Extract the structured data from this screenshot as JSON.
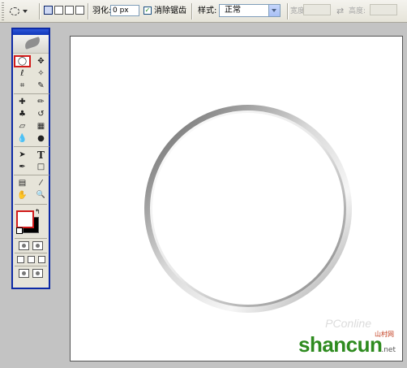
{
  "options_bar": {
    "feather_label": "羽化:",
    "feather_value": "0 px",
    "antialias_checked": "✓",
    "antialias_label": "消除锯齿",
    "style_label": "样式:",
    "style_value": "正常",
    "width_label": "宽度:",
    "height_label": "高度:",
    "swap_icon": "⇄"
  },
  "tools": {
    "glyphs": {
      "elliptical-marquee": "◯",
      "move": "✥",
      "lasso": "ℓ",
      "magic-wand": "✧",
      "crop": "⌗",
      "slice": "✎",
      "healing-brush": "✚",
      "brush": "✏",
      "clone-stamp": "♣",
      "history-brush": "↺",
      "eraser": "▱",
      "gradient": "▦",
      "blur": "💧",
      "dodge": "●",
      "path-selection": "➤",
      "type": "T",
      "pen": "✒",
      "rectangle": "□",
      "notes": "▤",
      "eyedropper": "⁄",
      "hand": "✋",
      "zoom": "🔍"
    }
  },
  "canvas": {
    "background": "#ffffff",
    "ring_inner": "#ffffff",
    "ring_edge_light": "#f2f2f2",
    "ring_edge_dark": "#6e6e6e"
  },
  "watermark": {
    "pc_text": "PConline",
    "brand": "shancun",
    "sub": "山村网",
    "tld": ".net"
  }
}
